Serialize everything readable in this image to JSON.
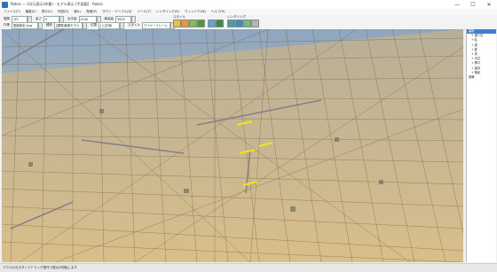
{
  "window": {
    "title": "Rebro — 3次元表示(作業) - モデル表示 [平面図] - Rebro",
    "minimize": "—",
    "maximize": "☐",
    "close": "✕"
  },
  "menu": [
    "ファイル(F)",
    "編集(E)",
    "表示(V)",
    "作図(D)",
    "線(L)",
    "配管(P)",
    "ダクト・ケーブル(D)",
    "ツール(T)",
    "レンダリング(R)",
    "ウィンドウ(W)",
    "ヘルプ(H)"
  ],
  "toolbar": {
    "row1": {
      "floor_label": "階層",
      "floor_value": "1FL",
      "height_label": "高さ",
      "height_value": "0",
      "floor_height_label": "全天高",
      "floor_height_value": "2100",
      "max_height_label": "最高高",
      "max_height_value": "3000"
    },
    "row2": {
      "layer_label": "作業",
      "layer_value": "図面設定.png",
      "type_label": "種別",
      "type_value": "[建物]構造モデル",
      "pos_label": "位置",
      "pos_value": "[上]平面",
      "style_label": "スタイル",
      "style_value": "ワイヤーフレーム"
    },
    "style_group_label": "スタイル",
    "view_group_label": "ビュー",
    "render_group_label": "レンダリング"
  },
  "tree": {
    "items": [
      {
        "label": "建物",
        "selected": true,
        "child": false
      },
      {
        "label": "+ 通り芯",
        "selected": false,
        "child": true
      },
      {
        "label": "+ 柱",
        "selected": false,
        "child": true
      },
      {
        "label": "+ 梁",
        "selected": false,
        "child": true
      },
      {
        "label": "+ 壁",
        "selected": false,
        "child": true
      },
      {
        "label": "+ 床",
        "selected": false,
        "child": true
      },
      {
        "label": "+ 天井",
        "selected": false,
        "child": true
      },
      {
        "label": "+ 開口",
        "selected": false,
        "child": true
      },
      {
        "label": "+ 建具",
        "selected": false,
        "child": true
      },
      {
        "label": "+ 階段",
        "selected": false,
        "child": true
      },
      {
        "label": "設備",
        "selected": false,
        "child": false
      }
    ]
  },
  "status": {
    "text": "マウスの左ボタンでドラッグ操作で視点が回転します"
  },
  "colors": {
    "accent": "#3d7fd6",
    "model": "#c9a35a",
    "highlight": "#f0e020"
  }
}
